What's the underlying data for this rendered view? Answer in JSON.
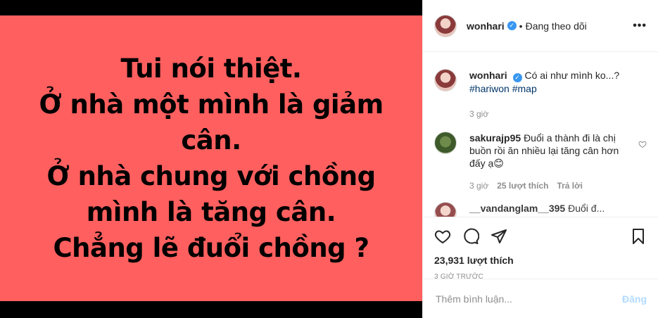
{
  "post": {
    "text_lines": [
      "Tui nói thiệt.",
      "Ở nhà một mình là giảm",
      "cân.",
      "Ở nhà chung với chồng",
      "mình là tăng cân.",
      "Chẳng lẽ đuổi chồng ?"
    ]
  },
  "header": {
    "username": "wonhari",
    "verified_icon": "verified-badge-icon",
    "separator": "•",
    "follow_label": "Đang theo dõi",
    "more_icon": "more-options-icon"
  },
  "caption": {
    "username": "wonhari",
    "text": "Có ai như mình ko...?",
    "hashtags": "#hariwon #map",
    "time": "3 giờ"
  },
  "comments": [
    {
      "username": "sakurajp95",
      "text": "Đuổi a thành đi là chị buồn rồi ăn nhiều lại tăng cân hơn đấy ạ😊",
      "time": "3 giờ",
      "likes": "25 lượt thích",
      "reply": "Trả lời"
    },
    {
      "username": "__vandanglam__395",
      "text": "Đuổi đ..."
    }
  ],
  "actions": {
    "like_icon": "heart-icon",
    "comment_icon": "comment-icon",
    "share_icon": "share-icon",
    "save_icon": "bookmark-icon"
  },
  "likes_count": "23,931 lượt thích",
  "timestamp": "3 GIỜ TRƯỚC",
  "add_comment": {
    "placeholder": "Thêm bình luận...",
    "post_label": "Đăng"
  },
  "colors": {
    "media_bg": "#ff5f5f",
    "link": "#003569",
    "verified": "#3897f0",
    "post_disabled": "#b3dbff"
  }
}
